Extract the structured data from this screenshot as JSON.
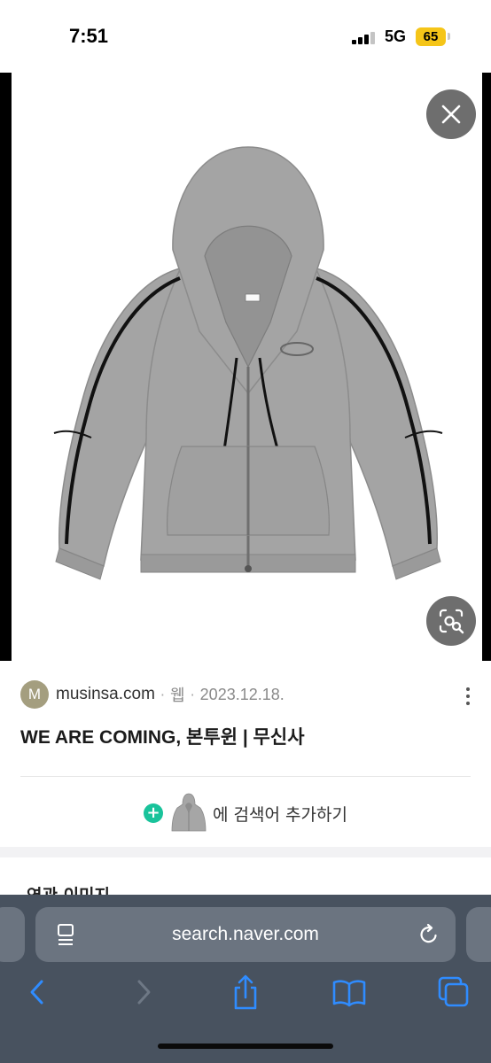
{
  "status_bar": {
    "time": "7:51",
    "network": "5G",
    "battery": "65"
  },
  "viewer": {
    "close_icon": "close-icon",
    "lens_icon": "image-search-icon",
    "product_image": "gray-zip-up-hoodie"
  },
  "result": {
    "favicon_letter": "M",
    "site": "musinsa.com",
    "separator": "·",
    "kind": "웹",
    "date": "2023.12.18.",
    "title": "WE ARE COMING, 본투윈 | 무신사",
    "add_label": "에 검색어 추가하기"
  },
  "related_heading": "연관 이미지",
  "safari": {
    "url": "search.naver.com",
    "toolbar": [
      "back-icon",
      "forward-icon",
      "share-icon",
      "bookmarks-icon",
      "tabs-icon"
    ]
  },
  "colors": {
    "accent_green": "#19c39b",
    "toolbar_blue": "#2f8cff",
    "safari_bg": "#48525f",
    "battery_yellow": "#f5c518"
  }
}
